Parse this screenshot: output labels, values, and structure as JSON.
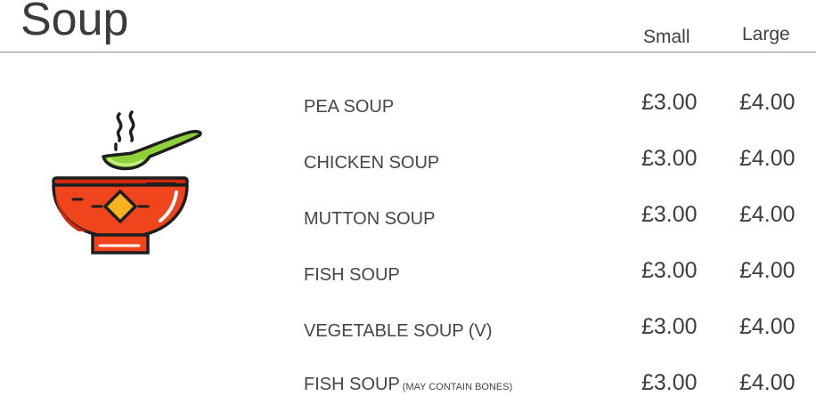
{
  "section": {
    "title": "Soup",
    "columns": {
      "small": "Small",
      "large": "Large"
    },
    "icon": "soup-bowl-icon"
  },
  "items": [
    {
      "name": "PEA SOUP",
      "note": "",
      "small": "£3.00",
      "large": "£4.00"
    },
    {
      "name": "CHICKEN SOUP",
      "note": "",
      "small": "£3.00",
      "large": "£4.00"
    },
    {
      "name": "MUTTON SOUP",
      "note": "",
      "small": "£3.00",
      "large": "£4.00"
    },
    {
      "name": "FISH SOUP",
      "note": "",
      "small": "£3.00",
      "large": "£4.00"
    },
    {
      "name": "VEGETABLE SOUP (V)",
      "note": "",
      "small": "£3.00",
      "large": "£4.00"
    },
    {
      "name": "FISH SOUP",
      "note": "(MAY CONTAIN BONES)",
      "small": "£3.00",
      "large": "£4.00"
    }
  ],
  "colors": {
    "bowl": "#f0441c",
    "bowl_dark": "#cf2a10",
    "spoon": "#8ed13a",
    "diamond": "#f7b21e",
    "outline": "#1e1e1e"
  }
}
